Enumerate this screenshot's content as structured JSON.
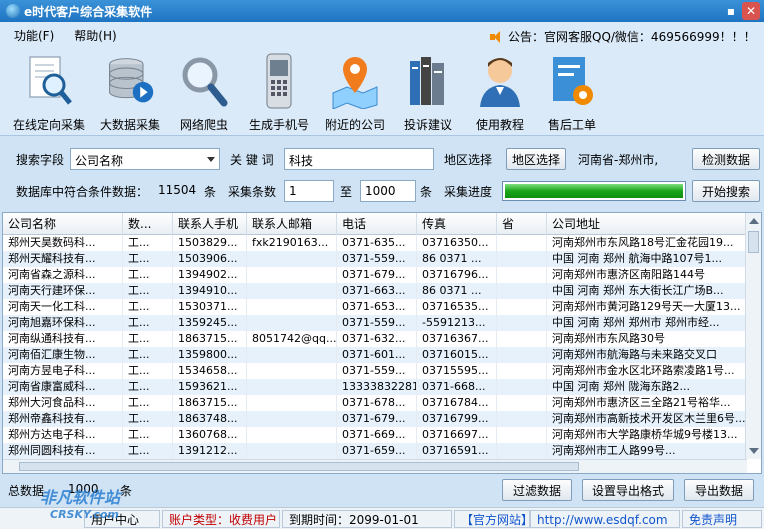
{
  "window": {
    "title": "e时代客户综合采集软件",
    "minimize_glyph": "▪",
    "close_glyph": "✕"
  },
  "menu": {
    "items": [
      "功能(F)",
      "帮助(H)"
    ]
  },
  "notice": {
    "text": "公告：官网客服QQ/微信：469566999！！！",
    "icon": "speaker-icon"
  },
  "toolbar": {
    "items": [
      {
        "label": "在线定向采集",
        "icon": "magnifier-document-icon"
      },
      {
        "label": "大数据采集",
        "icon": "database-icon"
      },
      {
        "label": "网络爬虫",
        "icon": "magnifier-icon"
      },
      {
        "label": "生成手机号",
        "icon": "phone-icon"
      },
      {
        "label": "附近的公司",
        "icon": "map-pin-icon"
      },
      {
        "label": "投诉建议",
        "icon": "books-icon"
      },
      {
        "label": "使用教程",
        "icon": "person-icon"
      },
      {
        "label": "售后工单",
        "icon": "document-gear-icon"
      }
    ]
  },
  "search": {
    "field_label": "搜索字段",
    "field_value": "公司名称",
    "keyword_label": "关 键 词",
    "keyword_value": "科技",
    "region_label": "地区选择",
    "region_button": "地区选择",
    "region_value": "河南省-郑州市,",
    "detect_button": "检测数据"
  },
  "collect": {
    "db_count_label": "数据库中符合条件数据：",
    "db_count": "11504",
    "unit1": "条",
    "count_label": "采集条数",
    "from_value": "1",
    "to_label": "至",
    "to_value": "1000",
    "unit2": "条",
    "progress_label": "采集进度",
    "progress_percent": 100,
    "start_button": "开始搜索"
  },
  "table": {
    "columns": [
      "公司名称",
      "数...",
      "联系人手机",
      "联系人邮箱",
      "电话",
      "传真",
      "省",
      "公司地址"
    ],
    "rows": [
      [
        "郑州天昊数码科...",
        "工...",
        "1503829...",
        "fxk2190163...",
        "0371-635...",
        "03716350...",
        "",
        "河南郑州市东风路18号汇金花园19..."
      ],
      [
        "郑州天耀科技有...",
        "工...",
        "1503906...",
        "",
        "0371-559...",
        "86 0371 ...",
        "",
        "中国 河南 郑州 航海中路107号1..."
      ],
      [
        "河南省森之源科...",
        "工...",
        "1394902...",
        "",
        "0371-679...",
        "03716796...",
        "",
        "河南郑州市惠济区南阳路144号"
      ],
      [
        "河南天行建环保...",
        "工...",
        "1394910...",
        "",
        "0371-663...",
        "86 0371 ...",
        "",
        "中国 河南 郑州 东大街长江广场B..."
      ],
      [
        "河南天一化工科...",
        "工...",
        "1530371...",
        "",
        "0371-653...",
        "03716535...",
        "",
        "河南郑州市黄河路129号天一大厦13..."
      ],
      [
        "河南旭嘉环保科...",
        "工...",
        "1359245...",
        "",
        "0371-559...",
        "-5591213...",
        "",
        "中国 河南 郑州 郑州市 郑州市经..."
      ],
      [
        "河南纵通科技有...",
        "工...",
        "1863715...",
        "8051742@qq...",
        "0371-632...",
        "03716367...",
        "",
        "河南郑州市东风路30号"
      ],
      [
        "河南佰汇康生物...",
        "工...",
        "1359800...",
        "",
        "0371-601...",
        "03716015...",
        "",
        "河南郑州市航海路与未来路交叉口"
      ],
      [
        "河南方昱电子科...",
        "工...",
        "1534658...",
        "",
        "0371-559...",
        "03715595...",
        "",
        "河南郑州市金水区北环路索凌路1号..."
      ],
      [
        "河南省康富威科...",
        "工...",
        "1593621...",
        "",
        "13333832281",
        "0371-668...",
        "",
        "中国 河南 郑州 陇海东路2..."
      ],
      [
        "郑州大河食品科...",
        "工...",
        "1863715...",
        "",
        "0371-678...",
        "03716784...",
        "",
        "河南郑州市惠济区三全路21号裕华..."
      ],
      [
        "郑州帝鑫科技有...",
        "工...",
        "1863748...",
        "",
        "0371-679...",
        "03716799...",
        "",
        "河南郑州市高新技术开发区木兰里6号..."
      ],
      [
        "郑州方达电子科...",
        "工...",
        "1360768...",
        "",
        "0371-669...",
        "03716697...",
        "",
        "河南郑州市大学路康桥华城9号楼13..."
      ],
      [
        "郑州同圆科技有...",
        "工...",
        "1391212...",
        "",
        "0371-659...",
        "03716591...",
        "",
        "河南郑州市工人路99号..."
      ]
    ]
  },
  "bottom": {
    "total_label": "总数据",
    "total_value": "1000",
    "total_unit": "条",
    "filter_button": "过滤数据",
    "export_format_button": "设置导出格式",
    "export_button": "导出数据"
  },
  "status": {
    "user_center": "用户中心",
    "account_type": "账户类型：收费用户",
    "expiry": "到期时间：2099-01-01",
    "website_label": "【官方网站】",
    "website_url": "http://www.esdqf.com",
    "disclaimer": "免责声明"
  },
  "watermark": {
    "line1": "非凡软件站",
    "line2": "CRSKY.com"
  }
}
